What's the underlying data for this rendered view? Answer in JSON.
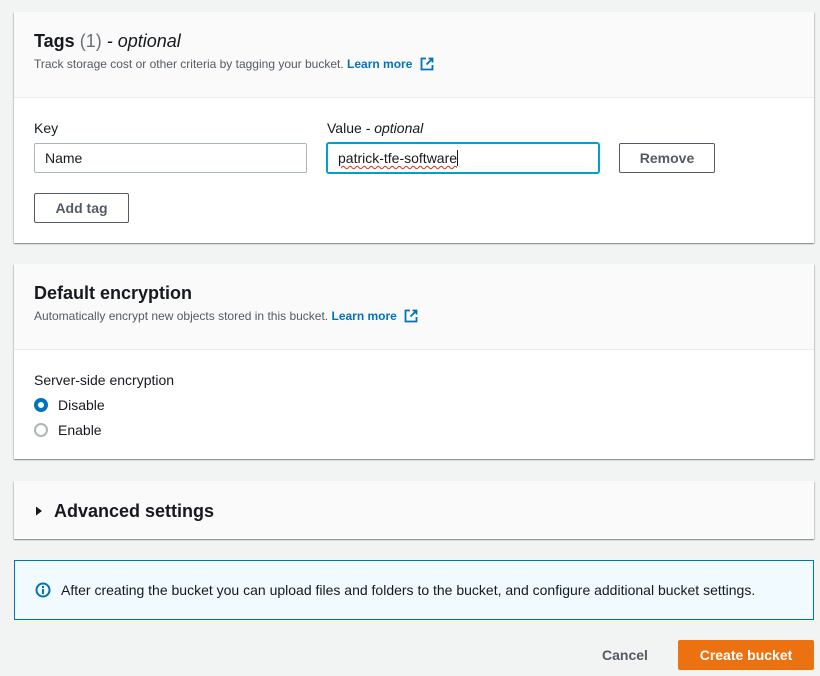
{
  "tags": {
    "title": "Tags",
    "count": "(1)",
    "title_suffix": "- optional",
    "description": "Track storage cost or other criteria by tagging your bucket.",
    "learn_more": "Learn more",
    "key_label": "Key",
    "value_label": "Value",
    "value_label_suffix": "- optional",
    "key_value": "Name",
    "value_value": "patrick-tfe-software",
    "remove_label": "Remove",
    "add_tag_label": "Add tag"
  },
  "encryption": {
    "title": "Default encryption",
    "description": "Automatically encrypt new objects stored in this bucket.",
    "learn_more": "Learn more",
    "sse_label": "Server-side encryption",
    "options": [
      {
        "label": "Disable",
        "selected": true
      },
      {
        "label": "Enable",
        "selected": false
      }
    ]
  },
  "advanced": {
    "title": "Advanced settings",
    "expanded": false
  },
  "info": {
    "icon": "info-icon",
    "text": "After creating the bucket you can upload files and folders to the bucket, and configure additional bucket settings."
  },
  "footer": {
    "cancel_label": "Cancel",
    "create_label": "Create bucket"
  },
  "colors": {
    "link": "#0073bb",
    "primary_button": "#ec7211",
    "focus_border": "#00a1c9",
    "info_background": "#f1faff"
  }
}
